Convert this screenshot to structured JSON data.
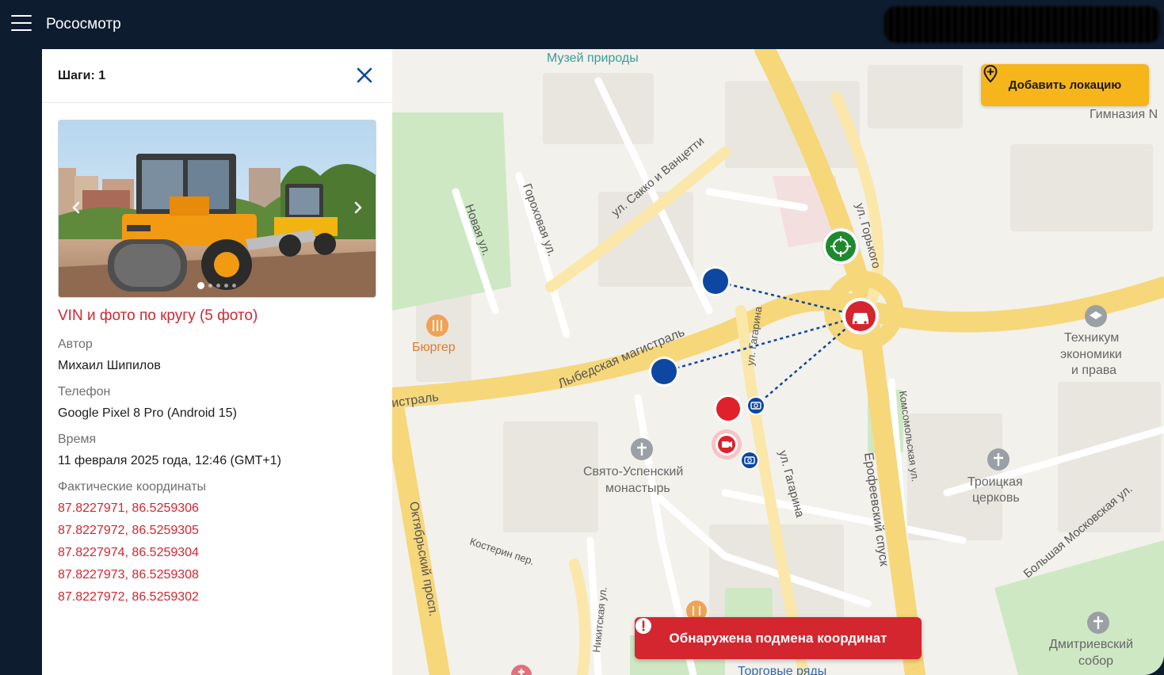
{
  "header": {
    "menu_icon": "hamburger-icon",
    "title": "Рососмотр"
  },
  "panel": {
    "steps_label": "Шаги: 1",
    "step_title": "VIN и фото по кругу (5 фото)",
    "author_label": "Автор",
    "author_value": "Михаил Шипилов",
    "phone_label": "Телефон",
    "phone_value": "Google Pixel 8 Pro (Android 15)",
    "time_label": "Время",
    "time_value": "11 февраля 2025 года, 12:46 (GMT+1)",
    "coords_label": "Фактические координаты",
    "coords": [
      "87.8227971, 86.5259306",
      "87.8227972, 86.5259305",
      "87.8227974, 86.5259304",
      "87.8227973, 86.5259308",
      "87.8227972, 86.5259302"
    ],
    "carousel": {
      "count": 5,
      "active": 1
    }
  },
  "map": {
    "add_location_label": "Добавить локацию",
    "alert_text": "Обнаружена подмена координат",
    "labels": {
      "museum": "Музей природы",
      "gymnasium": "Гимназия N",
      "sacco": "ул. Сакко и Ванцетти",
      "gorokhovaya": "Гороховая ул.",
      "novaya": "Новая ул.",
      "gorkogo": "ул. Горького",
      "lybed": "Лыбедская магистраль",
      "magistral": "истраль",
      "burger": "Бюргер",
      "gagarina_top": "ул. Гагарина",
      "gagarina": "ул. Гагарина",
      "monastery_1": "Свято-Успенский",
      "monastery_2": "монастырь",
      "tech_1": "Техникум",
      "tech_2": "экономики",
      "tech_3": "и права",
      "komsomol": "Комсомольская ул.",
      "erofeev": "Ерофеевский спуск",
      "troitsa_1": "Троицкая",
      "troitsa_2": "церковь",
      "oktyabr": "Октябрьский просп.",
      "kosterin": "Костерин пер.",
      "nikitskaya": "Никитская ул.",
      "moskovskaya": "Большая Московская ул.",
      "dmitriev_1": "Дмитриевский",
      "dmitriev_2": "собор",
      "torgovye": "Торговые ряды"
    }
  },
  "colors": {
    "accent_red": "#d3262f",
    "marker_blue": "#0d47a1",
    "marker_green": "#1e8a2e",
    "button_yellow": "#f7b51c",
    "header_bg": "#0e1c30"
  }
}
